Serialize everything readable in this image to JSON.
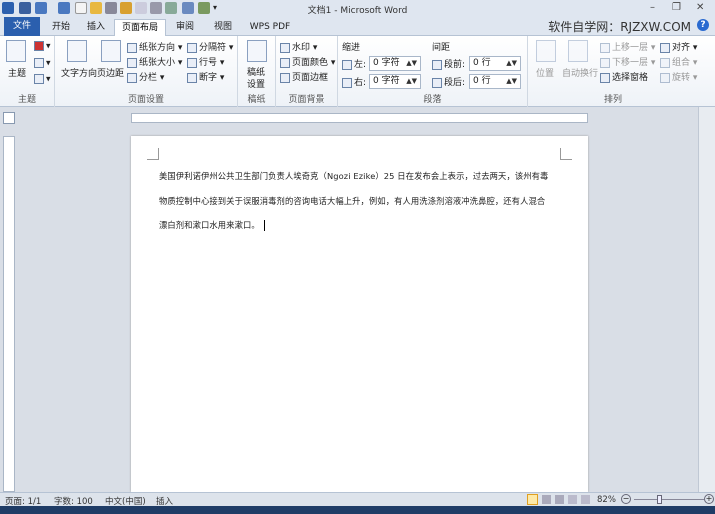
{
  "window": {
    "title": "文档1 - Microsoft Word",
    "min": "–",
    "restore": "❐",
    "close": "✕"
  },
  "brand": "软件自学网：RJZXW.COM",
  "help": "?",
  "tabs": [
    {
      "label": "文件"
    },
    {
      "label": "开始"
    },
    {
      "label": "插入"
    },
    {
      "label": "页面布局",
      "active": true
    },
    {
      "label": "审阅"
    },
    {
      "label": "视图"
    },
    {
      "label": "WPS PDF"
    }
  ],
  "ribbon": {
    "theme": {
      "label": "主题",
      "btn": "主题"
    },
    "page_setup": {
      "label": "页面设置",
      "text_direction": "文字方向",
      "margins": "页边距",
      "orientation": "纸张方向 ▾",
      "size": "纸张大小 ▾",
      "columns": "分栏 ▾",
      "breaks": "分隔符 ▾",
      "line_numbers": "行号 ▾",
      "hyphenation": "断字 ▾"
    },
    "manuscript": {
      "label": "稿纸",
      "btn1": "稿纸",
      "btn2": "设置"
    },
    "background": {
      "label": "页面背景",
      "watermark": "水印 ▾",
      "page_color": "页面颜色 ▾",
      "page_borders": "页面边框"
    },
    "paragraph": {
      "label": "段落",
      "indent": "缩进",
      "left_label": "左:",
      "left_value": "0 字符",
      "right_label": "右:",
      "right_value": "0 字符",
      "spacing": "间距",
      "before_label": "段前:",
      "before_value": "0 行",
      "after_label": "段后:",
      "after_value": "0 行"
    },
    "arrange": {
      "label": "排列",
      "position": "位置",
      "wrap": "自动换行",
      "bring_forward": "上移一层 ▾",
      "send_backward": "下移一层 ▾",
      "selection_pane": "选择窗格",
      "align": "对齐 ▾",
      "group": "组合 ▾",
      "rotate": "旋转 ▾"
    }
  },
  "document": {
    "lines": [
      "美国伊利诺伊州公共卫生部门负责人埃奇克（Ngozi Ezike）25 日在发布会上表示，过去两天，该州有毒",
      "物质控制中心接到关于误服消毒剂的咨询电话大幅上升，例如，有人用洗涤剂溶液冲洗鼻腔，还有人混合",
      "漂白剂和漱口水用来漱口。"
    ]
  },
  "status": {
    "page": "页面: 1/1",
    "words": "字数: 100",
    "language": "中文(中国)",
    "mode": "插入",
    "zoom": "82%",
    "zoom_value": 82
  }
}
